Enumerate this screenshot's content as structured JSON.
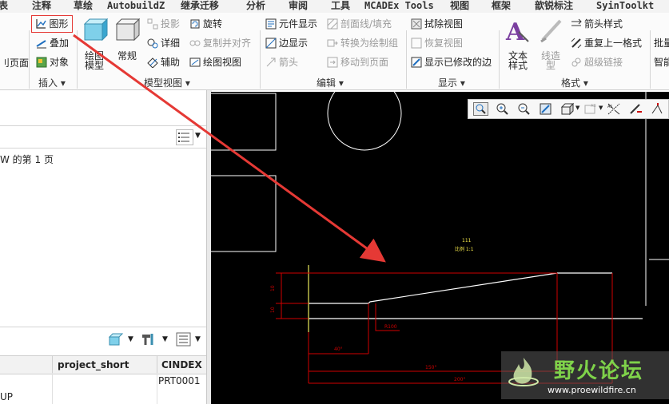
{
  "menubar": {
    "tabs": [
      "表",
      "注释",
      "草绘",
      "AutobuildZ",
      "继承迁移",
      "分析",
      "审阅",
      "工具",
      "MCADEx Tools",
      "视图",
      "框架",
      "歆锐标注",
      "SyinToolkt"
    ]
  },
  "ribbon": {
    "left_cut_label": "刂页面",
    "groups": {
      "insert": "插入",
      "model_views": "模型视图",
      "edit": "编辑",
      "display": "显示",
      "format": "格式"
    },
    "insert": {
      "graph": "图形",
      "overlay": "叠加",
      "object": "对象"
    },
    "model_views": {
      "drawing_model_1": "绘图",
      "drawing_model_2": "模型",
      "general": "常规",
      "projection": "投影",
      "detail": "详细",
      "auxiliary": "辅助",
      "rotate": "旋转",
      "copy_align": "复制并对齐",
      "drawing_view": "绘图视图"
    },
    "edit": {
      "component_display": "元件显示",
      "section_fill": "剖面线/填充",
      "edge_display": "边显示",
      "convert_to_drawing_group": "转换为绘制组",
      "arrow": "箭头",
      "move_to_page": "移动到页面"
    },
    "display": {
      "erase_view": "拭除视图",
      "restore_view": "恢复视图",
      "show_modified_edges": "显示已修改的边"
    },
    "format": {
      "text_style_1": "文本",
      "text_style_2": "样式",
      "line_style_1": "线造",
      "line_style_2": "型",
      "arrow_style": "箭头样式",
      "repeat_last_format": "重复上一格式",
      "hyperlink": "超级链接",
      "right_cut_1": "批量",
      "right_cut_2": "智能"
    }
  },
  "leftpanel": {
    "page_text": "W 的第 1 页",
    "table": {
      "columns": [
        "project_short",
        "CINDEX"
      ],
      "rows": [
        [
          "",
          "PRT0001"
        ],
        [
          "UP",
          ""
        ]
      ]
    }
  },
  "canvas": {
    "view_name_1": "111",
    "view_name_2": "比例 1:1",
    "dims": [
      "10",
      "10",
      "R100",
      "40°",
      "150°",
      "200°"
    ]
  },
  "watermark": {
    "title": "野火论坛",
    "url": "www.proewildfire.cn"
  },
  "colors": {
    "annotation_red": "#e53935",
    "dimension_red": "#d00000",
    "canvas": "#000000",
    "ribbon": "#fbfbfb"
  }
}
